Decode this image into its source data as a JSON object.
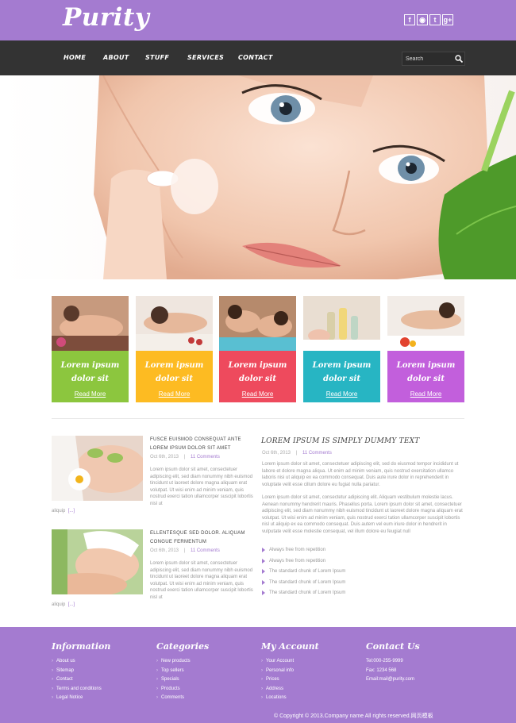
{
  "brand": {
    "logo": "Purity",
    "accent": "#a47bd0",
    "nav_bg": "#333333"
  },
  "social": [
    {
      "glyph": "f",
      "icon": "facebook-icon"
    },
    {
      "glyph": "◉",
      "icon": "rss-icon"
    },
    {
      "glyph": "t",
      "icon": "twitter-icon"
    },
    {
      "glyph": "g+",
      "icon": "googleplus-icon"
    }
  ],
  "nav": {
    "items": [
      "HOME",
      "ABOUT",
      "STUFF",
      "SERVICES",
      "CONTACT"
    ]
  },
  "search": {
    "placeholder": "Search",
    "value": ""
  },
  "cards": [
    {
      "caption": "Lorem ipsum dolor sit",
      "link": "Read More",
      "color": "#8cc63e"
    },
    {
      "caption": "Lorem ipsum dolor sit",
      "link": "Read More",
      "color": "#fdbb22"
    },
    {
      "caption": "Lorem ipsum dolor sit",
      "link": "Read More",
      "color": "#ee4a5d"
    },
    {
      "caption": "Lorem ipsum dolor sit",
      "link": "Read More",
      "color": "#27b5c3"
    },
    {
      "caption": "Lorem ipsum dolor sit",
      "link": "Read More",
      "color": "#c25fdc"
    }
  ],
  "posts": [
    {
      "title": "FUSCE EUISMOD CONSEQUAT ANTE LOREM IPSUM DOLOR SIT AMET",
      "date": "Oct 6th, 2013",
      "sep": "|",
      "comments": "11 Comments",
      "text": "Lorem ipsum dolor sit amet, consectetuer adipiscing elit, sed diam nonummy nibh euismod tincidunt ut laoreet dolore magna aliquam erat volutpat. Ut wisi enim ad minim veniam, quis nostrud exerci tation ullamcorper suscipit lobortis nisl ut",
      "after": "aliquip",
      "more": "[...]"
    },
    {
      "title": "ELLENTESQUE SED DOLOR. ALIQUAM CONGUE FERMENTUM",
      "date": "Oct 6th, 2013",
      "sep": "|",
      "comments": "11 Comments",
      "text": "Lorem ipsum dolor sit amet, consectetuer adipiscing elit, sed diam nonummy nibh euismod tincidunt ut laoreet dolore magna aliquam erat volutpat. Ut wisi enim ad minim veniam, quis nostrud exerci tation ullamcorper suscipit lobortis nisl ut",
      "after": "aliquip",
      "more": "[...]"
    }
  ],
  "feature": {
    "title": "LOREM IPSUM IS SIMPLY DUMMY TEXT",
    "date": "Oct 6th, 2013",
    "sep": "|",
    "comments": "11 Comments",
    "p1": "Lorem ipsum dolor sit amet, consectetuer adipiscing elit, sed do eiusmod tempor incididunt ut labore et dolore magna aliqua. Ut enim ad minim veniam, quis nostrud exercitation ullamco laboris nisi ut aliquip ex ea commodo consequat. Duis aute irure dolor in reprehenderit in voluptate velit esse cillum dolore eu fugiat nulla pariatur.",
    "p2": "Lorem ipsum dolor sit amet, consectetur adipiscing elit. Aliquam vestibulum molestie lacus. Aenean nonummy hendrerit mauris. Phasellus porta. Lorem ipsum dolor sit amet, consectetuer adipiscing elit, sed diam nonummy nibh euismod tincidunt ut laoreet dolore magna aliquam erat volutpat. Ut wisi enim ad minim veniam, quis nostrud exerci tation ullamcorper suscipit lobortis nisl ut aliquip ex ea commodo consequat. Duis autem vel eum iriure dolor in hendrerit in vulputate velit esse molestie consequat, vel illum dolore eu feugiat null",
    "list": [
      "Always free from repetition",
      "Always free from repetition",
      "The standard chunk of Lorem Ipsum",
      "The standard chunk of Lorem Ipsum",
      "The standard chunk of Lorem Ipsum"
    ]
  },
  "footer": {
    "information": {
      "title": "Information",
      "items": [
        "About us",
        "Sitemap",
        "Contact",
        "Terms and conditions",
        "Legal Notice"
      ]
    },
    "categories": {
      "title": "Categories",
      "items": [
        "New products",
        "Top sellers",
        "Specials",
        "Products",
        "Comments"
      ]
    },
    "account": {
      "title": "My Account",
      "items": [
        "Your Account",
        "Personal info",
        "Prices",
        "Address",
        "Locations"
      ]
    },
    "contact": {
      "title": "Contact Us",
      "items": [
        "Tel:000-255-9999",
        "Fax: 1234 568",
        "Email:mail@purity.com"
      ]
    },
    "copyright": "© Copyright © 2013.Company name All rights reserved.网页模板"
  }
}
